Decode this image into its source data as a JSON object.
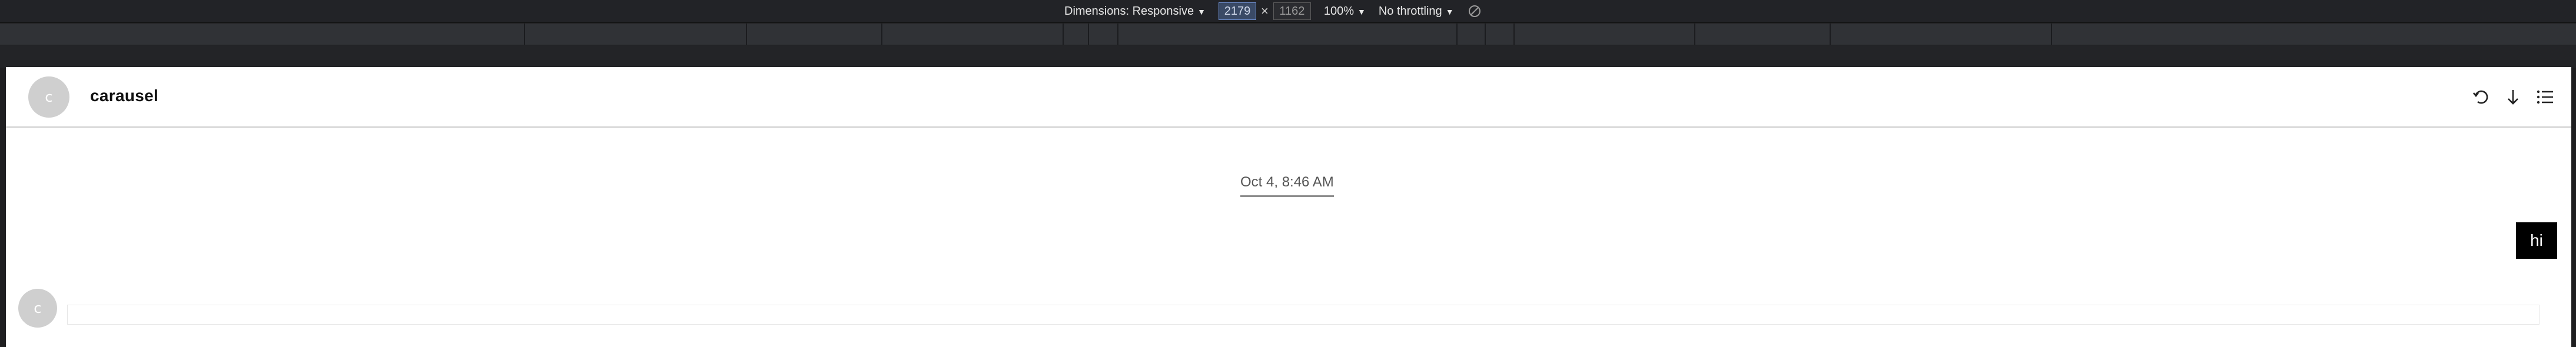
{
  "devtools": {
    "dimensions_label": "Dimensions: Responsive",
    "width_value": "2179",
    "times_symbol": "×",
    "height_value": "1162",
    "zoom_label": "100%",
    "throttle_label": "No throttling",
    "rotate_icon": "rotate-icon"
  },
  "header": {
    "avatar_letter": "c",
    "title": "carausel",
    "icons": [
      "refresh-icon",
      "download-icon",
      "list-icon"
    ]
  },
  "chat": {
    "timestamp": "Oct 4, 8:46 AM",
    "user_message": "hi",
    "bot_avatar_letter": "c"
  }
}
